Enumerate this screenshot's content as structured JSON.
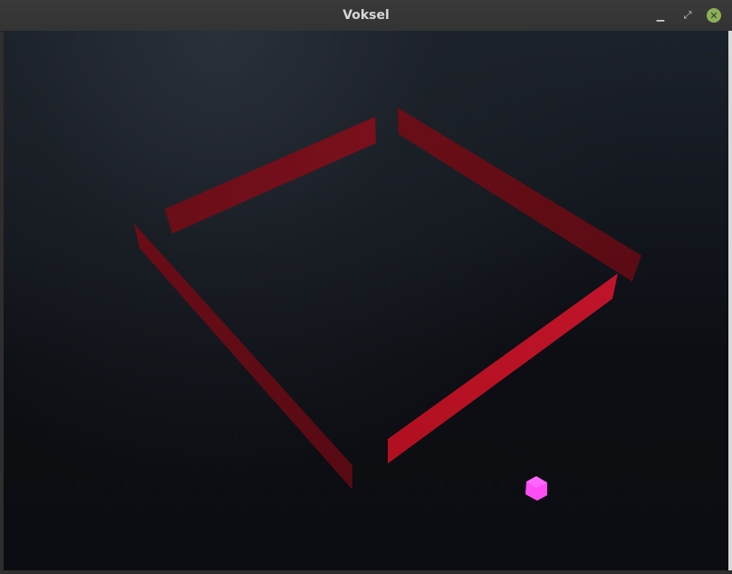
{
  "window": {
    "title": "Voksel",
    "minimize_glyph": "▁",
    "maximize_glyph": "⤢",
    "close_glyph": "✕"
  },
  "scene": {
    "background_color": "#0c0e13",
    "wall_color_dark": "#5e0d16",
    "wall_color_mid": "#6e0f18",
    "wall_color_bright": "#b3101f",
    "cube_color": "#ff4dff",
    "icons": {
      "minimize": "minimize-icon",
      "maximize": "maximize-icon",
      "close": "close-icon"
    }
  }
}
